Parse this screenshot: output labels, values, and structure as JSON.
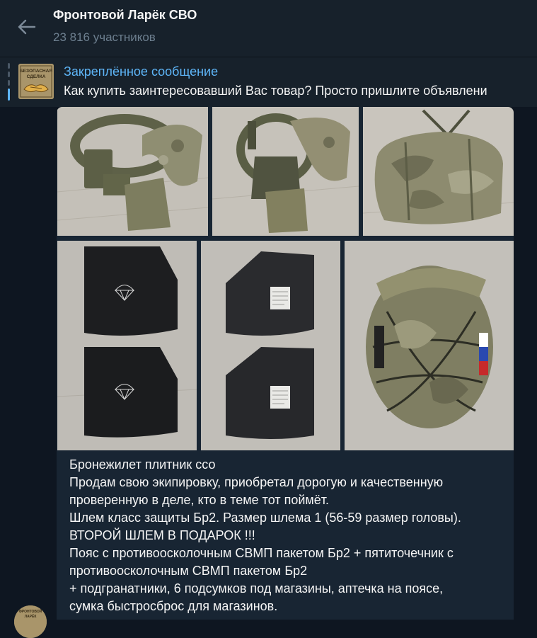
{
  "header": {
    "back_icon": "arrow-left-icon",
    "title": "Фронтовой Ларёк СВО",
    "subtitle": "23 816 участников"
  },
  "pinned": {
    "thumb_text_1": "БЕЗОПАСНАЯ",
    "thumb_text_2": "СДЕЛКА",
    "title": "Закреплённое сообщение",
    "text": "Как купить заинтересовавший Вас товар?   Просто пришлите объявлени"
  },
  "message": {
    "photos": [
      {
        "name": "vest-photo-1",
        "alt": "belt and plate carrier"
      },
      {
        "name": "vest-photo-2",
        "alt": "plate carrier harness"
      },
      {
        "name": "bag-photo",
        "alt": "camouflage duffel bag"
      },
      {
        "name": "plates-photo-1",
        "alt": "armor plates"
      },
      {
        "name": "plates-photo-2",
        "alt": "armor plates back side"
      },
      {
        "name": "helmet-photo",
        "alt": "camouflage helmet"
      }
    ],
    "lines": [
      "Бронежилет плитник ссо",
      "Продам свою экипировку, приобретал дорогую и качественную",
      "проверенную в деле, кто в теме тот поймёт.",
      "Шлем класс защиты Бр2. Размер шлема 1 (56-59 размер головы).",
      "ВТОРОЙ ШЛЕМ В ПОДАРОК !!!",
      "Пояс с противоосколочным СВМП пакетом Бр2 + пятиточечник с",
      "противоосколочным СВМП пакетом Бр2",
      "+ подгранатники, 6 подсумков под магазины, аптечка на поясе,",
      "сумка быстросброс для магазинов."
    ]
  },
  "avatar": {
    "text_1": "ФРОНТОВОЙ",
    "text_2": "ЛАРЁК"
  },
  "colors": {
    "background": "#0e1621",
    "header": "#17212b",
    "bubble": "#182533",
    "accent": "#5eb5f7",
    "muted": "#6d7f8f"
  }
}
